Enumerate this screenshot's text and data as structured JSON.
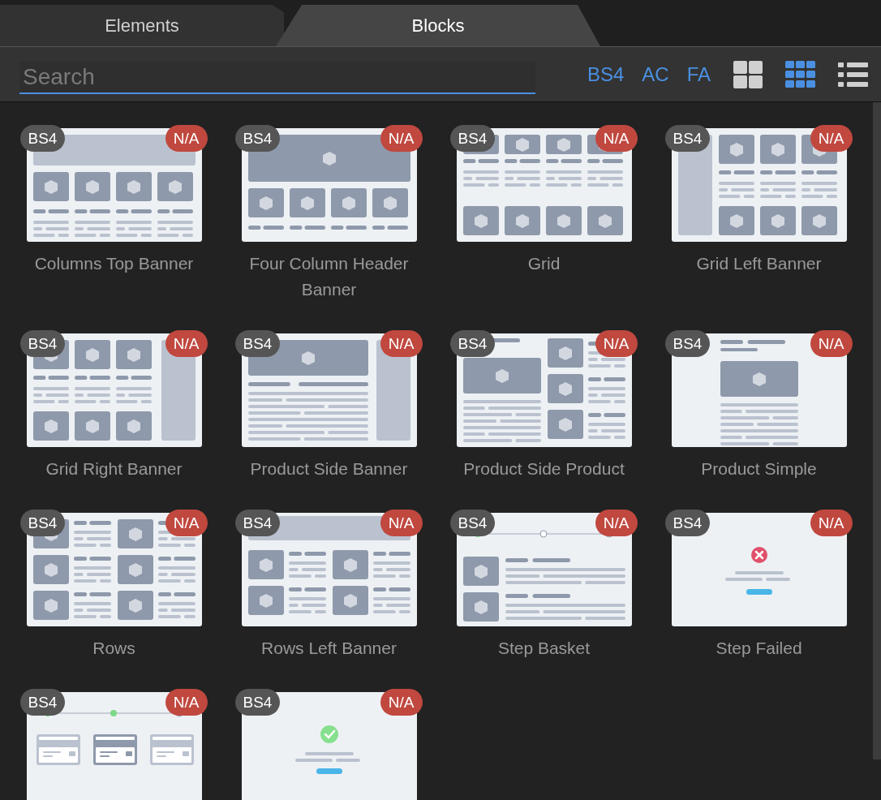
{
  "tabs": [
    {
      "label": "Elements",
      "selected": false
    },
    {
      "label": "Blocks",
      "selected": true
    }
  ],
  "search": {
    "placeholder": "Search"
  },
  "filters": [
    "BS4",
    "AC",
    "FA"
  ],
  "views": [
    {
      "kind": "large-grid",
      "selected": false
    },
    {
      "kind": "small-grid",
      "selected": true
    },
    {
      "kind": "list",
      "selected": false
    }
  ],
  "blocks": [
    {
      "label": "Columns Top Banner",
      "kind": "columns-top-banner",
      "framework": "BS4",
      "status": "N/A"
    },
    {
      "label": "Four Column Header Banner",
      "kind": "four-column-header-banner",
      "framework": "BS4",
      "status": "N/A"
    },
    {
      "label": "Grid",
      "kind": "grid",
      "framework": "BS4",
      "status": "N/A"
    },
    {
      "label": "Grid Left Banner",
      "kind": "grid-left-banner",
      "framework": "BS4",
      "status": "N/A"
    },
    {
      "label": "Grid Right Banner",
      "kind": "grid-right-banner",
      "framework": "BS4",
      "status": "N/A"
    },
    {
      "label": "Product Side Banner",
      "kind": "product-side-banner",
      "framework": "BS4",
      "status": "N/A"
    },
    {
      "label": "Product Side Product",
      "kind": "product-side-product",
      "framework": "BS4",
      "status": "N/A"
    },
    {
      "label": "Product Simple",
      "kind": "product-simple",
      "framework": "BS4",
      "status": "N/A"
    },
    {
      "label": "Rows",
      "kind": "rows",
      "framework": "BS4",
      "status": "N/A"
    },
    {
      "label": "Rows Left Banner",
      "kind": "rows-left-banner",
      "framework": "BS4",
      "status": "N/A"
    },
    {
      "label": "Step Basket",
      "kind": "step-basket",
      "framework": "BS4",
      "status": "N/A"
    },
    {
      "label": "Step Failed",
      "kind": "step-failed",
      "framework": "BS4",
      "status": "N/A"
    },
    {
      "kind": "step-payment",
      "framework": "BS4",
      "status": "N/A"
    },
    {
      "kind": "step-success",
      "framework": "BS4",
      "status": "N/A"
    }
  ]
}
